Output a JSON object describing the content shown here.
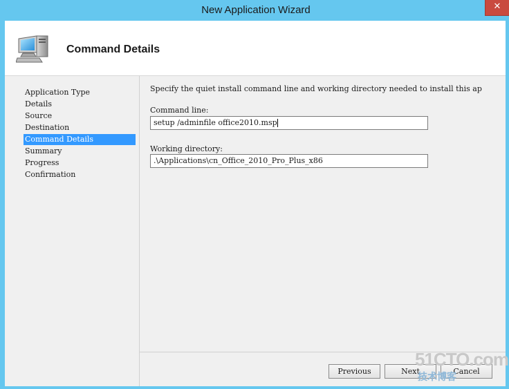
{
  "window": {
    "title": "New Application Wizard",
    "close_symbol": "✕"
  },
  "header": {
    "title": "Command Details",
    "icon": "computer-icon"
  },
  "nav": {
    "items": [
      {
        "label": "Application Type",
        "selected": false
      },
      {
        "label": "Details",
        "selected": false
      },
      {
        "label": "Source",
        "selected": false
      },
      {
        "label": "Destination",
        "selected": false
      },
      {
        "label": "Command Details",
        "selected": true
      },
      {
        "label": "Summary",
        "selected": false
      },
      {
        "label": "Progress",
        "selected": false
      },
      {
        "label": "Confirmation",
        "selected": false
      }
    ]
  },
  "content": {
    "instruction": "Specify the quiet install command line and working directory needed to install this ap",
    "command_line": {
      "label": "Command line:",
      "value": "setup /adminfile office2010.msp"
    },
    "working_directory": {
      "label": "Working directory:",
      "value": ".\\Applications\\cn_Office_2010_Pro_Plus_x86"
    }
  },
  "footer": {
    "previous_label": "Previous",
    "next_label": "Next",
    "cancel_label": "Cancel"
  },
  "watermark": {
    "main": "51CTO.com",
    "sub": "技术博客"
  },
  "colors": {
    "frame": "#65c7ef",
    "selection": "#3399ff",
    "close": "#c94a3f"
  }
}
